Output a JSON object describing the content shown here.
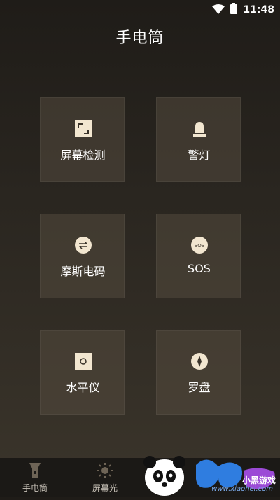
{
  "status": {
    "time": "11:48",
    "wifi_icon": "wifi-icon",
    "battery_icon": "battery-icon"
  },
  "header": {
    "title": "手电筒"
  },
  "tiles": [
    {
      "label": "屏幕检测",
      "icon": "screen-detect-icon"
    },
    {
      "label": "警灯",
      "icon": "warning-light-icon"
    },
    {
      "label": "摩斯电码",
      "icon": "morse-code-icon"
    },
    {
      "label": "SOS",
      "icon": "sos-icon",
      "icon_text": "SOS"
    },
    {
      "label": "水平仪",
      "icon": "level-icon"
    },
    {
      "label": "罗盘",
      "icon": "compass-icon"
    }
  ],
  "bottom_nav": [
    {
      "label": "手电筒",
      "icon": "flashlight-icon"
    },
    {
      "label": "屏幕光",
      "icon": "sun-icon"
    }
  ],
  "watermark": {
    "brand": "小黑游戏",
    "url": "www.xiaohei.com"
  },
  "colors": {
    "accent": "#f2e6d0",
    "tile_bg": "#4a4236",
    "nav_bg": "#1b1916"
  }
}
